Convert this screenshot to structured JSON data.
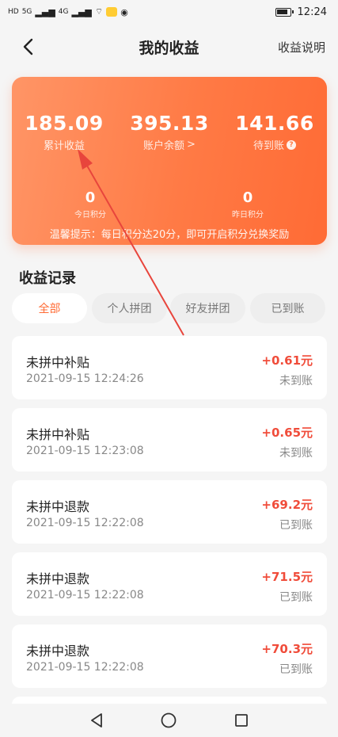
{
  "status_bar": {
    "left_indicators": [
      "HD",
      "5G",
      "4G"
    ],
    "time": "12:24"
  },
  "header": {
    "title": "我的收益",
    "back_icon": "chevron-left-icon",
    "help_label": "收益说明"
  },
  "summary": {
    "stats": [
      {
        "value": "185.09",
        "label": "累计收益"
      },
      {
        "value": "395.13",
        "label": "账户余额",
        "suffix": ">"
      },
      {
        "value": "141.66",
        "label": "待到账",
        "icon": "question-icon"
      }
    ],
    "points": [
      {
        "value": "0",
        "label": "今日积分"
      },
      {
        "value": "0",
        "label": "昨日积分"
      }
    ],
    "tip": "温馨提示：每日积分达20分，即可开启积分兑换奖励"
  },
  "records": {
    "title": "收益记录",
    "tabs": [
      "全部",
      "个人拼团",
      "好友拼团",
      "已到账"
    ],
    "active_tab": "全部",
    "items": [
      {
        "title": "未拼中补贴",
        "time": "2021-09-15 12:24:26",
        "amount": "+0.61元",
        "status": "未到账"
      },
      {
        "title": "未拼中补贴",
        "time": "2021-09-15 12:23:08",
        "amount": "+0.65元",
        "status": "未到账"
      },
      {
        "title": "未拼中退款",
        "time": "2021-09-15 12:22:08",
        "amount": "+69.2元",
        "status": "已到账"
      },
      {
        "title": "未拼中退款",
        "time": "2021-09-15 12:22:08",
        "amount": "+71.5元",
        "status": "已到账"
      },
      {
        "title": "未拼中退款",
        "time": "2021-09-15 12:22:08",
        "amount": "+70.3元",
        "status": "已到账"
      }
    ]
  },
  "colors": {
    "accent": "#ff6b35",
    "card_gradient_start": "#ff9566",
    "card_gradient_end": "#ff6b35",
    "amount": "#f04c3a",
    "annotation_arrow": "#e8453c"
  },
  "bottom_nav": {
    "icons": [
      "back-triangle-icon",
      "home-circle-icon",
      "recent-square-icon"
    ]
  }
}
